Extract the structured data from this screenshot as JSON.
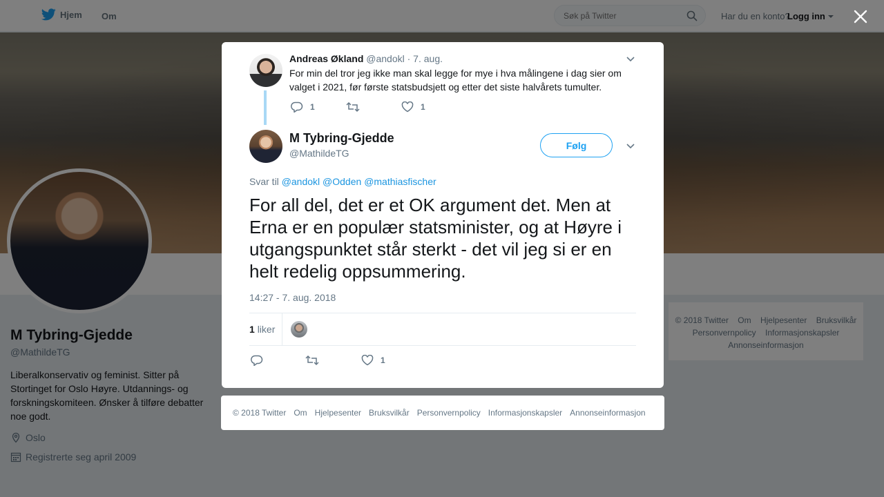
{
  "nav": {
    "home_label": "Hjem",
    "about_label": "Om",
    "search_placeholder": "Søk på Twitter",
    "account_question": "Har du en konto?",
    "login_label": "Logg inn"
  },
  "profile": {
    "name": "M Tybring-Gjedde",
    "handle": "@MathildeTG",
    "bio": "Liberalkonservativ og feminist. Sitter på Stortinget for Oslo Høyre. Utdannings- og forskningskomiteen. Ønsker å tilføre debatter noe godt.",
    "location": "Oslo",
    "joined": "Registrerte seg april 2009"
  },
  "right_footer": {
    "items": [
      "© 2018 Twitter",
      "Om",
      "Hjelpesenter",
      "Bruksvilkår",
      "Personvernpolicy",
      "Informasjonskapsler",
      "Annonseinformasjon"
    ]
  },
  "parent_tweet": {
    "name": "Andreas Økland",
    "handle": "@andokl",
    "date": "· 7. aug.",
    "text": "For min del tror jeg ikke man skal legge for mye i hva målingene i dag sier om valget i 2021, før første statsbudsjett og etter det siste halvårets tumulter.",
    "replies": "1",
    "likes": "1"
  },
  "main_tweet": {
    "name": "M Tybring-Gjedde",
    "handle": "@MathildeTG",
    "follow_label": "Følg",
    "reply_prefix": "Svar til",
    "mentions": [
      "@andokl",
      "@Odden",
      "@mathiasfischer"
    ],
    "text": "For all del, det er et OK argument det. Men at Erna er en populær statsminister, og at Høyre i utgangspunktet står sterkt - det vil jeg si er en helt redelig oppsummering.",
    "timestamp": "14:27 - 7. aug. 2018",
    "like_count": "1",
    "like_word": "liker",
    "action_likes": "1"
  },
  "modal_footer": {
    "items": [
      "© 2018 Twitter",
      "Om",
      "Hjelpesenter",
      "Bruksvilkår",
      "Personvernpolicy",
      "Informasjonskapsler",
      "Annonseinformasjon"
    ]
  },
  "colors": {
    "twitter_blue": "#1da1f2",
    "link_blue": "#1b95e0",
    "thread_line": "#a8d8f5",
    "text_secondary": "#657786"
  }
}
